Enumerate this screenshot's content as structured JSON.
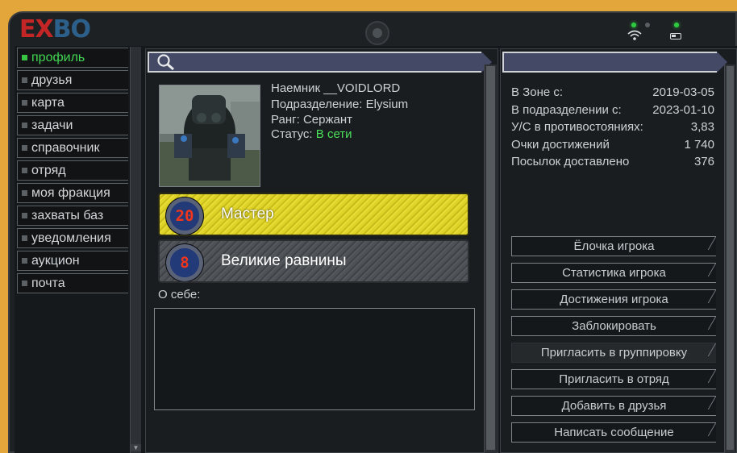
{
  "device": {
    "logo_part1": "EX",
    "logo_part2": "BO",
    "indicators": {
      "accent": "#2ecc40"
    }
  },
  "sidebar": {
    "items": [
      {
        "label": "профиль",
        "active": true
      },
      {
        "label": "друзья"
      },
      {
        "label": "карта"
      },
      {
        "label": "задачи"
      },
      {
        "label": "справочник"
      },
      {
        "label": "отряд"
      },
      {
        "label": "моя фракция"
      },
      {
        "label": "захваты баз"
      },
      {
        "label": "уведомления"
      },
      {
        "label": "аукцион"
      },
      {
        "label": "почта"
      }
    ]
  },
  "profile": {
    "name_line": "Наемник __VOIDLORD",
    "division_line": "Подразделение: Elysium",
    "rank_line": "Ранг: Сержант",
    "status_prefix": "Статус: ",
    "status_value": "В сети",
    "status_color": "#4ce05a",
    "about_label": "О себе:",
    "about_text": ""
  },
  "ranks": [
    {
      "badge": "20",
      "label": "Мастер",
      "style": "gold"
    },
    {
      "badge": "8",
      "label": "Великие равнины",
      "style": "grey"
    }
  ],
  "stats": [
    {
      "label": "В Зоне с:",
      "value": "2019-03-05"
    },
    {
      "label": "В подразделении с:",
      "value": "2023-01-10"
    },
    {
      "label": "У/С в противостояниях:",
      "value": "3,83"
    },
    {
      "label": "Очки достижений",
      "value": "1 740"
    },
    {
      "label": "Посылок доставлено",
      "value": "376"
    }
  ],
  "actions": [
    {
      "label": "Ёлочка игрока"
    },
    {
      "label": "Статистика игрока"
    },
    {
      "label": "Достижения игрока"
    },
    {
      "label": "Заблокировать"
    },
    {
      "label": "Пригласить в группировку",
      "disabled": true
    },
    {
      "label": "Пригласить в отряд"
    },
    {
      "label": "Добавить в друзья"
    },
    {
      "label": "Написать сообщение"
    }
  ]
}
